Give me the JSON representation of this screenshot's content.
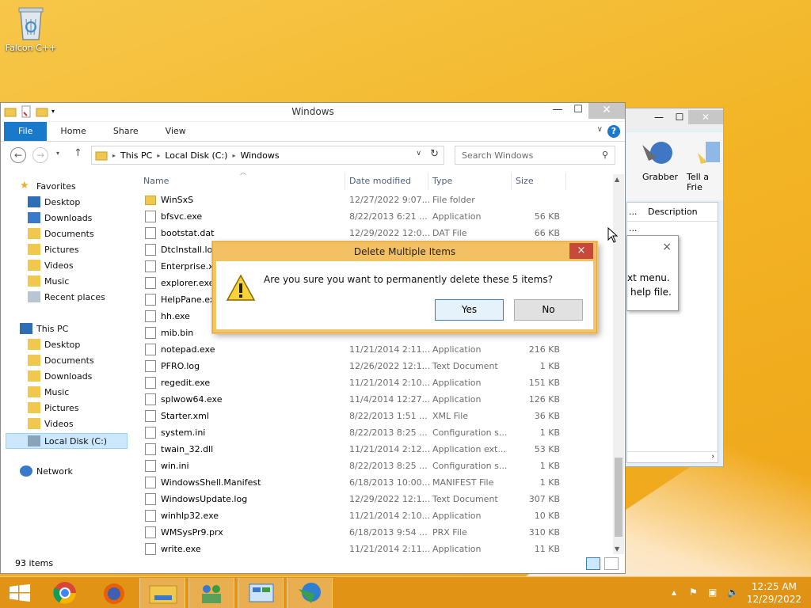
{
  "desktop": {
    "icon_label": "Falcon C++"
  },
  "bg_window": {
    "ribbon_items": [
      "Grabber",
      "Tell a Frie"
    ],
    "col_header": "Description",
    "tooltip_lines": [
      "xt menu.",
      "help file."
    ],
    "tooltip_close": "×",
    "col_header_dots": "...",
    "row_dots": "..."
  },
  "explorer": {
    "title": "Windows",
    "tabs": [
      "File",
      "Home",
      "Share",
      "View"
    ],
    "help": "?",
    "address": [
      "This PC",
      "Local Disk (C:)",
      "Windows"
    ],
    "search_placeholder": "Search Windows",
    "columns": [
      "Name",
      "Date modified",
      "Type",
      "Size"
    ],
    "nav": {
      "favorites": "Favorites",
      "fav_items": [
        "Desktop",
        "Downloads",
        "Documents",
        "Pictures",
        "Videos",
        "Music",
        "Recent places"
      ],
      "this_pc": "This PC",
      "pc_items": [
        "Desktop",
        "Documents",
        "Downloads",
        "Music",
        "Pictures",
        "Videos",
        "Local Disk (C:)"
      ],
      "network": "Network"
    },
    "files": [
      {
        "name": "WinSxS",
        "date": "12/27/2022 9:07...",
        "type": "File folder",
        "size": ""
      },
      {
        "name": "bfsvc.exe",
        "date": "8/22/2013 6:21 ...",
        "type": "Application",
        "size": "56 KB"
      },
      {
        "name": "bootstat.dat",
        "date": "12/29/2022 12:0...",
        "type": "DAT File",
        "size": "66 KB"
      },
      {
        "name": "DtcInstall.log",
        "date": "",
        "type": "",
        "size": ""
      },
      {
        "name": "Enterprise.xml",
        "date": "",
        "type": "",
        "size": ""
      },
      {
        "name": "explorer.exe",
        "date": "",
        "type": "",
        "size": ""
      },
      {
        "name": "HelpPane.exe",
        "date": "",
        "type": "",
        "size": ""
      },
      {
        "name": "hh.exe",
        "date": "",
        "type": "",
        "size": ""
      },
      {
        "name": "mib.bin",
        "date": "",
        "type": "",
        "size": ""
      },
      {
        "name": "notepad.exe",
        "date": "11/21/2014 2:11...",
        "type": "Application",
        "size": "216 KB"
      },
      {
        "name": "PFRO.log",
        "date": "12/26/2022 12:1...",
        "type": "Text Document",
        "size": "1 KB"
      },
      {
        "name": "regedit.exe",
        "date": "11/21/2014 2:10...",
        "type": "Application",
        "size": "151 KB"
      },
      {
        "name": "splwow64.exe",
        "date": "11/4/2014 12:27...",
        "type": "Application",
        "size": "126 KB"
      },
      {
        "name": "Starter.xml",
        "date": "8/22/2013 1:51 ...",
        "type": "XML File",
        "size": "36 KB"
      },
      {
        "name": "system.ini",
        "date": "8/22/2013 8:25 ...",
        "type": "Configuration s...",
        "size": "1 KB"
      },
      {
        "name": "twain_32.dll",
        "date": "11/21/2014 2:12...",
        "type": "Application ext...",
        "size": "53 KB"
      },
      {
        "name": "win.ini",
        "date": "8/22/2013 8:25 ...",
        "type": "Configuration s...",
        "size": "1 KB"
      },
      {
        "name": "WindowsShell.Manifest",
        "date": "6/18/2013 10:00...",
        "type": "MANIFEST File",
        "size": "1 KB"
      },
      {
        "name": "WindowsUpdate.log",
        "date": "12/29/2022 12:1...",
        "type": "Text Document",
        "size": "307 KB"
      },
      {
        "name": "winhlp32.exe",
        "date": "11/21/2014 2:10...",
        "type": "Application",
        "size": "10 KB"
      },
      {
        "name": "WMSysPr9.prx",
        "date": "6/18/2013 9:54 ...",
        "type": "PRX File",
        "size": "310 KB"
      },
      {
        "name": "write.exe",
        "date": "11/21/2014 2:11...",
        "type": "Application",
        "size": "11 KB"
      }
    ],
    "status": "93 items"
  },
  "dialog": {
    "title": "Delete Multiple Items",
    "message": "Are you sure you want to permanently delete these 5 items?",
    "yes": "Yes",
    "no": "No",
    "close": "×"
  },
  "taskbar": {
    "time": "12:25 AM",
    "date": "12/29/2022",
    "apps": [
      "chrome-icon",
      "firefox-icon",
      "file-explorer-icon",
      "network-users-icon",
      "control-panel-icon",
      "download-manager-icon"
    ]
  },
  "colors": {
    "accent": "#1979ca",
    "dialog_border": "#f2c56a",
    "taskbar": "#de9114"
  }
}
